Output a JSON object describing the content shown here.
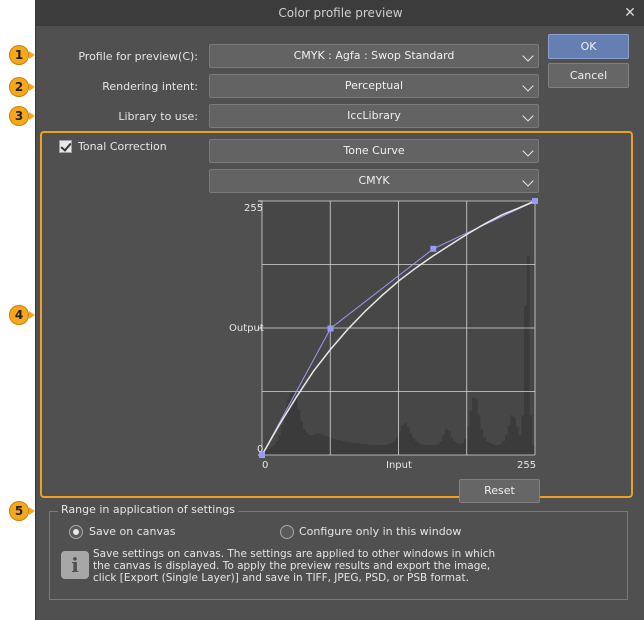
{
  "window": {
    "title": "Color profile preview",
    "close_glyph": "✕"
  },
  "badges": [
    "1",
    "2",
    "3",
    "4",
    "5"
  ],
  "fields": {
    "profile_label": "Profile for preview(C):",
    "profile_value": "CMYK : Agfa : Swop Standard",
    "intent_label": "Rendering intent:",
    "intent_value": "Perceptual",
    "library_label": "Library to use:",
    "library_value": "IccLibrary"
  },
  "buttons": {
    "ok": "OK",
    "cancel": "Cancel",
    "reset": "Reset"
  },
  "tonal": {
    "checkbox_label": "Tonal Correction",
    "checked": true,
    "method_value": "Tone Curve",
    "channel_value": "CMYK"
  },
  "chart_data": {
    "type": "line",
    "xlabel": "Input",
    "ylabel": "Output",
    "xlim": [
      0,
      255
    ],
    "ylim": [
      0,
      255
    ],
    "x_ticks": [
      "0",
      "255"
    ],
    "y_ticks": [
      "0",
      "255"
    ],
    "grid": true,
    "control_points": [
      [
        0,
        0
      ],
      [
        64,
        127
      ],
      [
        160,
        207
      ],
      [
        255,
        255
      ]
    ],
    "curve": [
      [
        0,
        0
      ],
      [
        16,
        30
      ],
      [
        32,
        58
      ],
      [
        48,
        84
      ],
      [
        64,
        106
      ],
      [
        80,
        126
      ],
      [
        96,
        144
      ],
      [
        112,
        160
      ],
      [
        128,
        175
      ],
      [
        144,
        188
      ],
      [
        160,
        200
      ],
      [
        176,
        211
      ],
      [
        192,
        222
      ],
      [
        208,
        232
      ],
      [
        224,
        241
      ],
      [
        240,
        248
      ],
      [
        255,
        255
      ]
    ],
    "histogram": [
      4,
      5,
      6,
      8,
      10,
      14,
      20,
      30,
      44,
      56,
      62,
      64,
      58,
      46,
      34,
      26,
      22,
      20,
      20,
      21,
      22,
      21,
      20,
      19,
      18,
      17,
      16,
      15,
      15,
      14,
      14,
      13,
      13,
      12,
      12,
      12,
      11,
      11,
      11,
      10,
      10,
      10,
      10,
      10,
      10,
      10,
      11,
      12,
      14,
      18,
      24,
      30,
      32,
      28,
      22,
      17,
      14,
      12,
      11,
      10,
      10,
      10,
      10,
      10,
      11,
      14,
      20,
      26,
      24,
      18,
      14,
      12,
      11,
      12,
      16,
      28,
      44,
      58,
      56,
      40,
      26,
      18,
      14,
      12,
      11,
      10,
      10,
      11,
      14,
      20,
      30,
      40,
      38,
      28,
      20,
      40,
      150,
      200,
      40,
      10
    ],
    "colors": {
      "curve": "#e8e8e8",
      "control": "#9a9af5",
      "histogram": "#3b3b3b",
      "plot_bg": "#474747",
      "grid": "#d8d8d8"
    }
  },
  "range": {
    "legend": "Range in application of settings",
    "option_canvas": "Save on canvas",
    "option_window": "Configure only in this window",
    "selected": "Save on canvas",
    "info_glyph": "i",
    "info_line1": "Save settings on canvas. The settings are applied to other windows in which",
    "info_line2": "the canvas is displayed. To apply the preview results and export the image,",
    "info_line3": "click [Export (Single Layer)] and save in TIFF, JPEG, PSD, or PSB format."
  },
  "theme": {
    "accent": "#f0a020",
    "primary_button": "#667fb3",
    "dialog_bg": "#505050"
  }
}
